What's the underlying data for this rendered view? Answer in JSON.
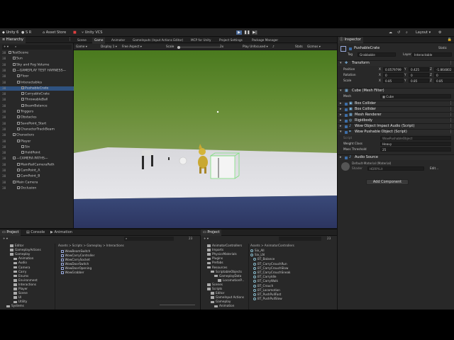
{
  "colors": {
    "accent": "#2f5280",
    "play_active": "#4a6a9a",
    "editor_bg": "#282828"
  },
  "toolbar": {
    "account": "Unity 6",
    "user": "S R",
    "asset_store": "Asset Store",
    "version_control": "Unity VCS",
    "layout": "Layout"
  },
  "hierarchy": {
    "tab": "Hierarchy",
    "rows": [
      {
        "num": "38",
        "label": "TestScene",
        "indent": 0
      },
      {
        "num": "38",
        "label": "Sun",
        "indent": 1
      },
      {
        "num": "38",
        "label": "Sky and Fog Volume",
        "indent": 1
      },
      {
        "num": "38",
        "label": "—GAMEPLAY TEST HARNESS—",
        "indent": 1
      },
      {
        "num": "38",
        "label": "Floor",
        "indent": 2
      },
      {
        "num": "38",
        "label": "Interactables",
        "indent": 2
      },
      {
        "num": "38",
        "label": "PushableCrate",
        "indent": 3,
        "selected": true
      },
      {
        "num": "38",
        "label": "CarryableCrate",
        "indent": 3
      },
      {
        "num": "38",
        "label": "ThrowableBall",
        "indent": 3
      },
      {
        "num": "38",
        "label": "BeamBalance",
        "indent": 3
      },
      {
        "num": "38",
        "label": "Triggers",
        "indent": 2
      },
      {
        "num": "38",
        "label": "Obstacles",
        "indent": 2
      },
      {
        "num": "38",
        "label": "SavePoint_Start",
        "indent": 2
      },
      {
        "num": "38",
        "label": "CharacterTrackBeam",
        "indent": 2
      },
      {
        "num": "38",
        "label": "Characters",
        "indent": 1
      },
      {
        "num": "38",
        "label": "Player",
        "indent": 2
      },
      {
        "num": "38",
        "label": "Six",
        "indent": 3
      },
      {
        "num": "38",
        "label": "HoldPoint",
        "indent": 3
      },
      {
        "num": "38",
        "label": "—CAMERA PATHS—",
        "indent": 1
      },
      {
        "num": "38",
        "label": "MainRailCameraPath",
        "indent": 2
      },
      {
        "num": "38",
        "label": "CamPoint_A",
        "indent": 2
      },
      {
        "num": "38",
        "label": "CamPoint_B",
        "indent": 2
      },
      {
        "num": "38",
        "label": "Main Camera",
        "indent": 1
      },
      {
        "num": "38",
        "label": "Occlusion",
        "indent": 2
      }
    ]
  },
  "game": {
    "tabs": [
      "Scene",
      "Game",
      "Animator",
      "GameInputs (Input Actions Editor)",
      "MCP for Unity",
      "Project Settings",
      "Package Manager"
    ],
    "active_tab": "Game",
    "toolbar": {
      "mode": "Game",
      "display": "Display 1",
      "aspect": "Free Aspect",
      "scale_label": "Scale",
      "scale_value": "2x",
      "play_focus": "Play Unfocused",
      "stats": "Stats",
      "gizmos": "Gizmos"
    }
  },
  "inspector": {
    "tab": "Inspector",
    "object_name": "PushableCrate",
    "static_label": "Static",
    "tag_label": "Tag",
    "tag_value": "Grabbable",
    "layer_label": "Layer",
    "layer_value": "Interactable",
    "transform": {
      "title": "Transform",
      "position": {
        "label": "Position",
        "x": "0.0579799",
        "y": "0.425",
        "z": "-1.864802"
      },
      "rotation": {
        "label": "Rotation",
        "x": "0",
        "y": "0",
        "z": "0"
      },
      "scale": {
        "label": "Scale",
        "x": "0.85",
        "y": "0.85",
        "z": "0.85"
      }
    },
    "mesh_filter": {
      "title": "Cube (Mesh Filter)",
      "mesh_label": "Mesh",
      "mesh_value": "Cube"
    },
    "components": [
      "Box Collider",
      "Box Collider",
      "Mesh Renderer",
      "Rigidbody",
      "Wow Object Impact Audio (Script)",
      "Wow Pushable Object (Script)"
    ],
    "pushable": {
      "script_label": "Script",
      "script_value": "WowPushableObject",
      "weight_label": "Weight Class",
      "weight_value": "Heavy",
      "mass_label": "Mass Threshold",
      "mass_value": "25"
    },
    "audio_source": {
      "title": "Audio Source",
      "shader": "Default-Material (Material)",
      "shader_label": "Shader",
      "shader_value": "HDRP/Lit",
      "edit": "Edit..."
    },
    "add_component": "Add Component"
  },
  "project_left": {
    "tabs": [
      "Project",
      "Console",
      "Animation"
    ],
    "tree": [
      "Editor",
      "GameplayActions",
      "Gameplay",
      "Animation",
      "Audio",
      "Camera",
      "Carry",
      "Enums",
      "Environment",
      "Interactions",
      "Player",
      "Scene",
      "UI",
      "Utility",
      "Systems"
    ],
    "breadcrumb": "Assets > Scripts > Gameplay > Interactions",
    "files": [
      "WowBeamSwitch",
      "WowCarryController",
      "WowCarrySocket",
      "WowDoorSwitch",
      "WowDoorOpening",
      "WowGrabber"
    ],
    "count": "23"
  },
  "project_right": {
    "tab": "Project",
    "tree": [
      "AnimatorControllers",
      "Imports",
      "PhysicsMaterials",
      "Plugins",
      "Prefabs",
      "Resources",
      "ScriptableObjects",
      "GameplayData",
      "LocomotionP...",
      "Scenes",
      "Scripts",
      "Editor",
      "GameInput Actions",
      "Gameplay",
      "Animation"
    ],
    "breadcrumb": "Assets > AnimatorControllers",
    "files": [
      "Six_All",
      "Six_LN",
      "BT_Balance",
      "BT_CarryCrouchRun",
      "BT_CarryCrouchSlow",
      "BT_CarryCrouchSneak",
      "BT_CarryIdle",
      "BT_CarryWalk",
      "BT_Crouch",
      "BT_Locomotion",
      "BT_PushPullFast",
      "BT_PushPullSlow"
    ],
    "count": "23"
  }
}
